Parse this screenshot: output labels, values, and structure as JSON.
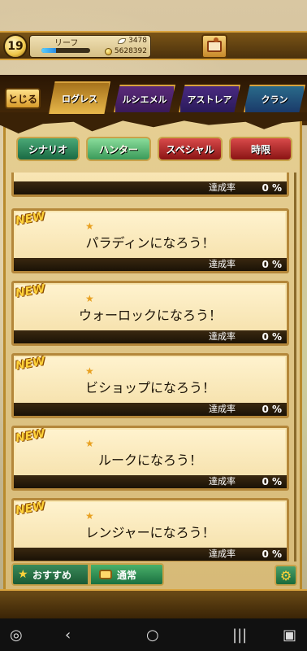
{
  "player": {
    "level": "19",
    "name": "リーフ",
    "leaf_count": "3478",
    "gold": "5628392",
    "exp_fraction": 0.3
  },
  "nav": {
    "close_label": "とじる",
    "tabs": [
      {
        "label": "ログレス",
        "active": true
      },
      {
        "label": "ルシエメル",
        "active": false
      },
      {
        "label": "アストレア",
        "active": false
      },
      {
        "label": "クラン",
        "active": false
      }
    ]
  },
  "filters": [
    {
      "label": "シナリオ",
      "style": "green"
    },
    {
      "label": "ハンター",
      "style": "green-active"
    },
    {
      "label": "スペシャル",
      "style": "red"
    },
    {
      "label": "時限",
      "style": "red"
    }
  ],
  "achievements": [
    {
      "title": "",
      "new": false,
      "rate_label": "達成率",
      "rate": "0 %"
    },
    {
      "title": "パラディンになろう！",
      "new": true,
      "rate_label": "達成率",
      "rate": "0 %"
    },
    {
      "title": "ウォーロックになろう！",
      "new": true,
      "rate_label": "達成率",
      "rate": "0 %"
    },
    {
      "title": "ビショップになろう！",
      "new": true,
      "rate_label": "達成率",
      "rate": "0 %"
    },
    {
      "title": "ルークになろう！",
      "new": true,
      "rate_label": "達成率",
      "rate": "0 %"
    },
    {
      "title": "レンジャーになろう！",
      "new": true,
      "rate_label": "達成率",
      "rate": "0 %"
    }
  ],
  "new_badge_text": "NEW",
  "bottom": {
    "recommended_label": "おすすめ",
    "normal_label": "通常"
  },
  "colors": {
    "gold_border": "#d9a33d",
    "card_bg": "#fff3cf",
    "green_button": "#1a6a44",
    "red_button": "#8a1414"
  }
}
